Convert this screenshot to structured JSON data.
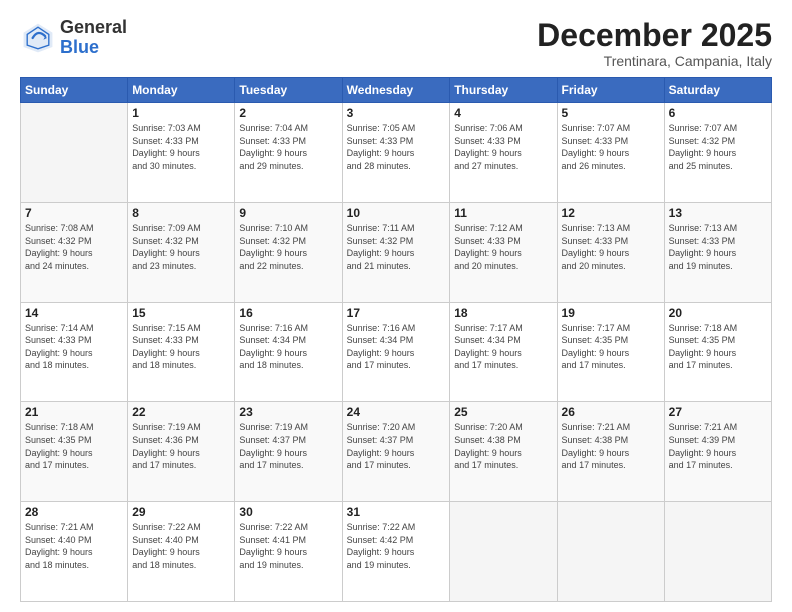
{
  "header": {
    "logo_general": "General",
    "logo_blue": "Blue",
    "month": "December 2025",
    "location": "Trentinara, Campania, Italy"
  },
  "days_of_week": [
    "Sunday",
    "Monday",
    "Tuesday",
    "Wednesday",
    "Thursday",
    "Friday",
    "Saturday"
  ],
  "weeks": [
    [
      {
        "day": "",
        "info": ""
      },
      {
        "day": "1",
        "info": "Sunrise: 7:03 AM\nSunset: 4:33 PM\nDaylight: 9 hours\nand 30 minutes."
      },
      {
        "day": "2",
        "info": "Sunrise: 7:04 AM\nSunset: 4:33 PM\nDaylight: 9 hours\nand 29 minutes."
      },
      {
        "day": "3",
        "info": "Sunrise: 7:05 AM\nSunset: 4:33 PM\nDaylight: 9 hours\nand 28 minutes."
      },
      {
        "day": "4",
        "info": "Sunrise: 7:06 AM\nSunset: 4:33 PM\nDaylight: 9 hours\nand 27 minutes."
      },
      {
        "day": "5",
        "info": "Sunrise: 7:07 AM\nSunset: 4:33 PM\nDaylight: 9 hours\nand 26 minutes."
      },
      {
        "day": "6",
        "info": "Sunrise: 7:07 AM\nSunset: 4:32 PM\nDaylight: 9 hours\nand 25 minutes."
      }
    ],
    [
      {
        "day": "7",
        "info": "Sunrise: 7:08 AM\nSunset: 4:32 PM\nDaylight: 9 hours\nand 24 minutes."
      },
      {
        "day": "8",
        "info": "Sunrise: 7:09 AM\nSunset: 4:32 PM\nDaylight: 9 hours\nand 23 minutes."
      },
      {
        "day": "9",
        "info": "Sunrise: 7:10 AM\nSunset: 4:32 PM\nDaylight: 9 hours\nand 22 minutes."
      },
      {
        "day": "10",
        "info": "Sunrise: 7:11 AM\nSunset: 4:32 PM\nDaylight: 9 hours\nand 21 minutes."
      },
      {
        "day": "11",
        "info": "Sunrise: 7:12 AM\nSunset: 4:33 PM\nDaylight: 9 hours\nand 20 minutes."
      },
      {
        "day": "12",
        "info": "Sunrise: 7:13 AM\nSunset: 4:33 PM\nDaylight: 9 hours\nand 20 minutes."
      },
      {
        "day": "13",
        "info": "Sunrise: 7:13 AM\nSunset: 4:33 PM\nDaylight: 9 hours\nand 19 minutes."
      }
    ],
    [
      {
        "day": "14",
        "info": "Sunrise: 7:14 AM\nSunset: 4:33 PM\nDaylight: 9 hours\nand 18 minutes."
      },
      {
        "day": "15",
        "info": "Sunrise: 7:15 AM\nSunset: 4:33 PM\nDaylight: 9 hours\nand 18 minutes."
      },
      {
        "day": "16",
        "info": "Sunrise: 7:16 AM\nSunset: 4:34 PM\nDaylight: 9 hours\nand 18 minutes."
      },
      {
        "day": "17",
        "info": "Sunrise: 7:16 AM\nSunset: 4:34 PM\nDaylight: 9 hours\nand 17 minutes."
      },
      {
        "day": "18",
        "info": "Sunrise: 7:17 AM\nSunset: 4:34 PM\nDaylight: 9 hours\nand 17 minutes."
      },
      {
        "day": "19",
        "info": "Sunrise: 7:17 AM\nSunset: 4:35 PM\nDaylight: 9 hours\nand 17 minutes."
      },
      {
        "day": "20",
        "info": "Sunrise: 7:18 AM\nSunset: 4:35 PM\nDaylight: 9 hours\nand 17 minutes."
      }
    ],
    [
      {
        "day": "21",
        "info": "Sunrise: 7:18 AM\nSunset: 4:35 PM\nDaylight: 9 hours\nand 17 minutes."
      },
      {
        "day": "22",
        "info": "Sunrise: 7:19 AM\nSunset: 4:36 PM\nDaylight: 9 hours\nand 17 minutes."
      },
      {
        "day": "23",
        "info": "Sunrise: 7:19 AM\nSunset: 4:37 PM\nDaylight: 9 hours\nand 17 minutes."
      },
      {
        "day": "24",
        "info": "Sunrise: 7:20 AM\nSunset: 4:37 PM\nDaylight: 9 hours\nand 17 minutes."
      },
      {
        "day": "25",
        "info": "Sunrise: 7:20 AM\nSunset: 4:38 PM\nDaylight: 9 hours\nand 17 minutes."
      },
      {
        "day": "26",
        "info": "Sunrise: 7:21 AM\nSunset: 4:38 PM\nDaylight: 9 hours\nand 17 minutes."
      },
      {
        "day": "27",
        "info": "Sunrise: 7:21 AM\nSunset: 4:39 PM\nDaylight: 9 hours\nand 17 minutes."
      }
    ],
    [
      {
        "day": "28",
        "info": "Sunrise: 7:21 AM\nSunset: 4:40 PM\nDaylight: 9 hours\nand 18 minutes."
      },
      {
        "day": "29",
        "info": "Sunrise: 7:22 AM\nSunset: 4:40 PM\nDaylight: 9 hours\nand 18 minutes."
      },
      {
        "day": "30",
        "info": "Sunrise: 7:22 AM\nSunset: 4:41 PM\nDaylight: 9 hours\nand 19 minutes."
      },
      {
        "day": "31",
        "info": "Sunrise: 7:22 AM\nSunset: 4:42 PM\nDaylight: 9 hours\nand 19 minutes."
      },
      {
        "day": "",
        "info": ""
      },
      {
        "day": "",
        "info": ""
      },
      {
        "day": "",
        "info": ""
      }
    ]
  ]
}
